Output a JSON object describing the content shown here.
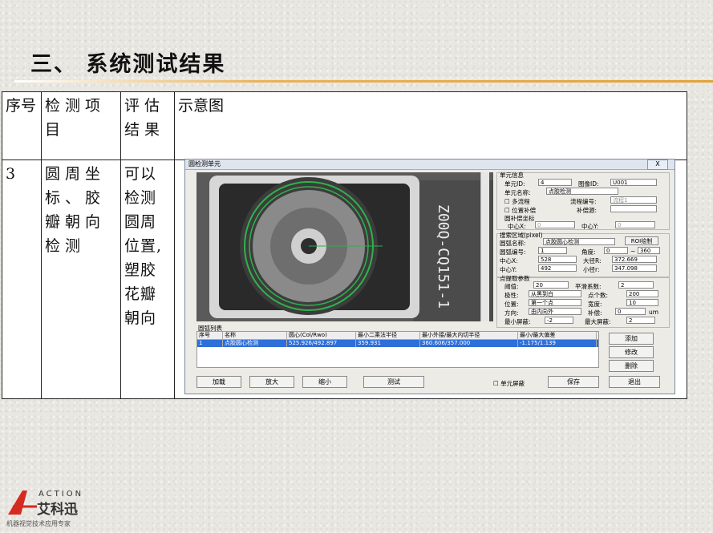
{
  "title": "三、 系统测试结果",
  "table": {
    "headers": {
      "seq": "序号",
      "item": "检测项目",
      "result": "评估结果",
      "diagram": "示意图"
    },
    "row": {
      "seq": "3",
      "item": "圆周坐标、胶瓣朝向检测",
      "result": "可以检测圆周位置,塑胶花瓣朝向"
    }
  },
  "dialog": {
    "title": "圆检测单元",
    "close": "X",
    "unit_info": "单元信息",
    "unit_id_label": "单元ID:",
    "unit_id": "4",
    "image_id_label": "图像ID:",
    "image_id": "U001",
    "unit_name_label": "单元名称:",
    "unit_name": "点胶检测",
    "multi_flow": "多流程",
    "flow_no_label": "流程编号:",
    "flow_no": "流程1",
    "pos_comp": "位置补偿",
    "comp_src_label": "补偿源:",
    "circle_comp": "圆补偿坐标",
    "cx_label": "中心X:",
    "cx": "0",
    "cy_label": "中心Y:",
    "cy": "0",
    "search_region": "搜索区域(pixel)",
    "arc_name_label": "圆弧名称:",
    "arc_name": "点胶圆心检测",
    "roi_btn": "ROI绘制",
    "arc_no_label": "圆弧编号:",
    "arc_no": "1",
    "angle_label": "角度:",
    "angle_from": "0",
    "angle_sep": "~",
    "angle_to": "360",
    "center_x_label": "中心X:",
    "center_x": "528",
    "rmax_label": "大径R:",
    "rmax": "372.669",
    "center_y_label": "中心Y:",
    "center_y": "492",
    "rmin_label": "小径r:",
    "rmin": "347.098",
    "point_params": "点提取参数",
    "thresh_label": "阈值:",
    "thresh": "20",
    "smooth_label": "平滑系数:",
    "smooth": "2",
    "polarity_label": "极性:",
    "polarity": "从黑到白",
    "npoints_label": "点个数:",
    "npoints": "200",
    "position_label": "位置:",
    "position": "第一个点",
    "width_label": "宽度:",
    "width": "10",
    "direction_label": "方向:",
    "direction": "由内向外",
    "offset_label": "补偿:",
    "offset": "0",
    "offset_unit": "um",
    "minmask_label": "最小屏蔽:",
    "minmask": "-2",
    "maxmask_label": "最大屏蔽:",
    "maxmask": "2",
    "arc_list": "圆弧列表",
    "list_headers": [
      "序号",
      "名称",
      "圆心(Col/Rwo)",
      "最小二乘法半径",
      "最小外接/最大内切半径",
      "最小/最大偏差"
    ],
    "list_row": [
      "1",
      "点胶圆心检测",
      "525.926/492.897",
      "359.931",
      "360.606/357.000",
      "-1.175/1.139"
    ],
    "btn_add": "添加",
    "btn_edit": "修改",
    "btn_delete": "删除",
    "btn_load": "加载",
    "btn_zoomin": "放大",
    "btn_zoomout": "缩小",
    "btn_test": "测试",
    "unit_mask": "单元屏蔽",
    "btn_save": "保存",
    "btn_exit": "退出",
    "sensor_text": "Z00Q-CQ151-1"
  },
  "logo": {
    "word": "ACTION",
    "name": "艾科迅",
    "slogan": "机器视觉技术应用专家"
  }
}
